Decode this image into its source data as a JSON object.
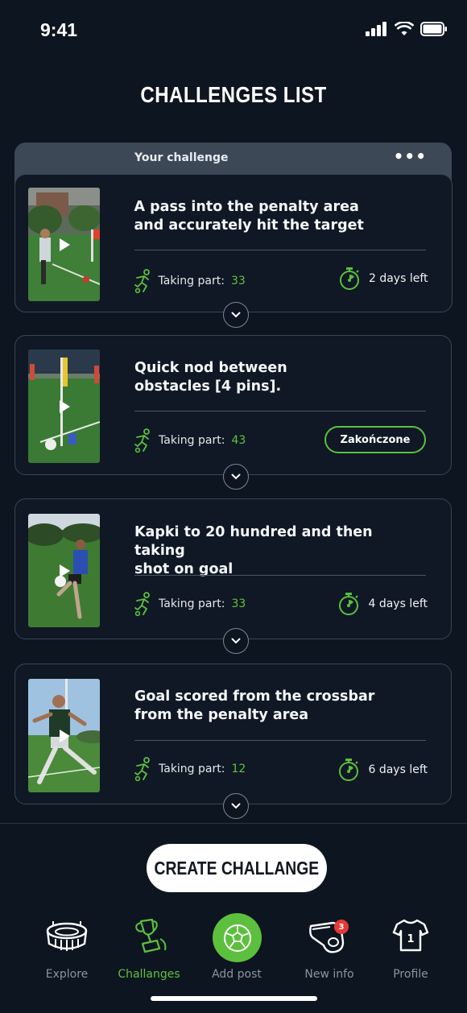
{
  "status": {
    "time": "9:41"
  },
  "header": {
    "title": "CHALLENGES LIST"
  },
  "your_challenge": {
    "label": "Your challenge",
    "menu": "•••"
  },
  "challenges": [
    {
      "title_line1": "A pass into the penalty area",
      "title_line2": "and accurately hit the target",
      "participants_label": "Taking part:",
      "participants": "33",
      "time_left": "2 days left"
    },
    {
      "title_line1": "Quick nod between",
      "title_line2": "obstacles [4 pins].",
      "participants_label": "Taking part:",
      "participants": "43",
      "status": "Zakończone"
    },
    {
      "title_line1": "Kapki to 20 hundred and then taking",
      "title_line2": "shot on goal",
      "participants_label": "Taking part:",
      "participants": "33",
      "time_left": "4 days left"
    },
    {
      "title_line1": "Goal scored from the crossbar",
      "title_line2": "from the penalty area",
      "participants_label": "Taking part:",
      "participants": "12",
      "time_left": "6 days left"
    }
  ],
  "create_button": "CREATE CHALLANGE",
  "nav": {
    "items": [
      {
        "label": "Explore",
        "icon": "stadium-icon"
      },
      {
        "label": "Challanges",
        "icon": "trophy-icon",
        "active": true
      },
      {
        "label": "Add post",
        "icon": "ball-icon"
      },
      {
        "label": "New info",
        "icon": "whistle-icon",
        "badge": "3"
      },
      {
        "label": "Profile",
        "icon": "jersey-icon",
        "jersey_number": "1"
      }
    ]
  },
  "colors": {
    "accent": "#5cc03e",
    "background": "#0d1520",
    "card_border": "#3a4656",
    "badge": "#e53935"
  }
}
